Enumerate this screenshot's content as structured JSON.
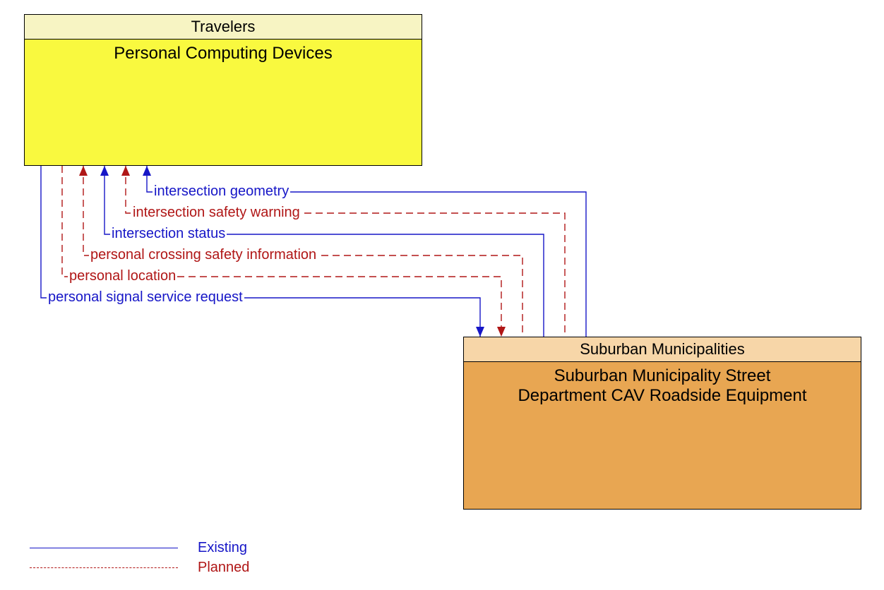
{
  "boxes": {
    "travelers": {
      "header": "Travelers",
      "body": "Personal Computing Devices"
    },
    "suburban": {
      "header": "Suburban Municipalities",
      "body_line1": "Suburban Municipality Street",
      "body_line2": "Department CAV Roadside Equipment"
    }
  },
  "flows": {
    "f1": {
      "label": "intersection geometry",
      "style": "existing",
      "from": "suburban",
      "to": "travelers"
    },
    "f2": {
      "label": "intersection safety warning",
      "style": "planned",
      "from": "suburban",
      "to": "travelers"
    },
    "f3": {
      "label": "intersection status",
      "style": "existing",
      "from": "suburban",
      "to": "travelers"
    },
    "f4": {
      "label": "personal crossing safety information",
      "style": "planned",
      "from": "suburban",
      "to": "travelers"
    },
    "f5": {
      "label": "personal location",
      "style": "planned",
      "from": "travelers",
      "to": "suburban"
    },
    "f6": {
      "label": "personal signal service request",
      "style": "existing",
      "from": "travelers",
      "to": "suburban"
    }
  },
  "legend": {
    "existing": "Existing",
    "planned": "Planned"
  },
  "colors": {
    "existing": "#1616c7",
    "planned": "#b01616",
    "travelers_header": "#f7f4c3",
    "travelers_body": "#f9f93f",
    "suburban_header": "#f7d6a8",
    "suburban_body": "#e8a652"
  }
}
